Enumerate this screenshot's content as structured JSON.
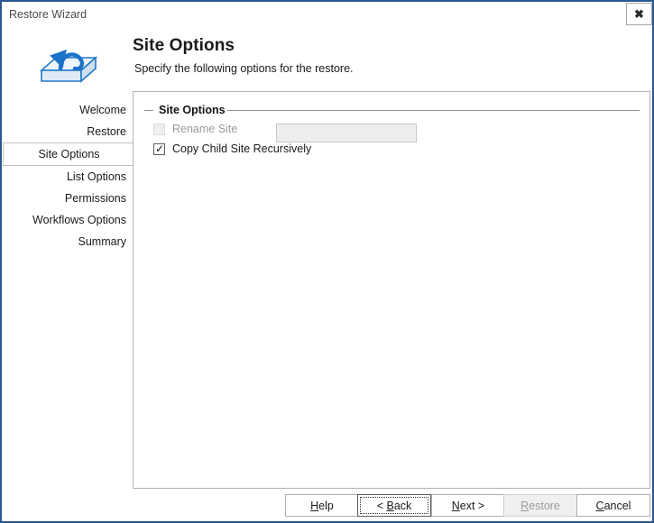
{
  "window": {
    "title": "Restore Wizard",
    "close_label": "✖",
    "border_color": "#29588c"
  },
  "header": {
    "title": "Site Options",
    "subtitle": "Specify the following options for the restore.",
    "icon": "restore-box-arrow-icon"
  },
  "sidebar": {
    "items": [
      {
        "label": "Welcome",
        "selected": false
      },
      {
        "label": "Restore",
        "selected": false
      },
      {
        "label": "Site Options",
        "selected": true
      },
      {
        "label": "List Options",
        "selected": false
      },
      {
        "label": "Permissions",
        "selected": false
      },
      {
        "label": "Workflows Options",
        "selected": false
      },
      {
        "label": "Summary",
        "selected": false
      }
    ]
  },
  "content": {
    "groupbox_legend": "Site Options",
    "rename_site": {
      "label": "Rename Site",
      "checked": false,
      "enabled": false
    },
    "rename_input": {
      "value": "",
      "placeholder": "",
      "enabled": false
    },
    "copy_child_site_recursively": {
      "label": "Copy Child Site Recursively",
      "checked": true,
      "enabled": true,
      "check_glyph": "✓"
    }
  },
  "buttons": {
    "help": {
      "mnemonic": "H",
      "before": "",
      "after": "elp",
      "enabled": true,
      "focused": false
    },
    "back": {
      "mnemonic": "B",
      "before": "< ",
      "after": "ack",
      "enabled": true,
      "focused": true
    },
    "next": {
      "mnemonic": "N",
      "before": "",
      "after": "ext >",
      "enabled": true,
      "focused": false
    },
    "restore": {
      "mnemonic": "R",
      "before": "",
      "after": "estore",
      "enabled": false,
      "focused": false
    },
    "cancel": {
      "mnemonic": "C",
      "before": "",
      "after": "ancel",
      "enabled": true,
      "focused": false
    }
  }
}
